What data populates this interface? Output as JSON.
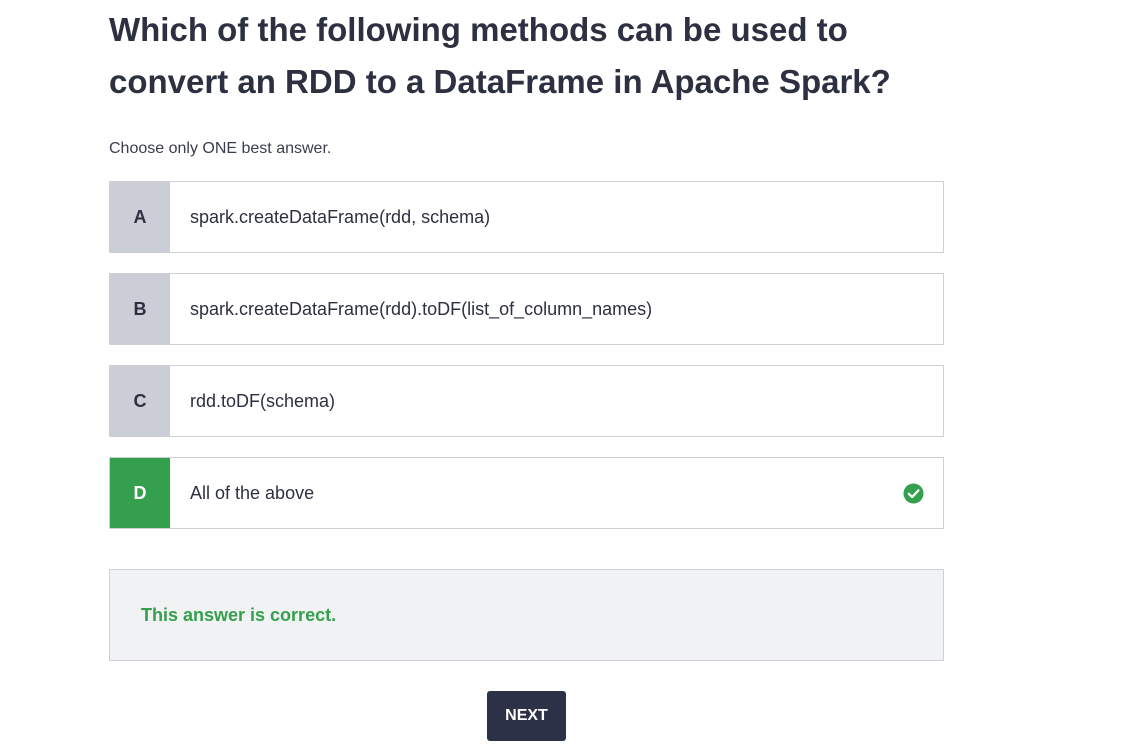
{
  "question": {
    "title": "Which of the following methods can be used to convert an RDD to a DataFrame in Apache Spark?",
    "instruction": "Choose only ONE best answer."
  },
  "options": [
    {
      "letter": "A",
      "text": "spark.createDataFrame(rdd, schema)",
      "correct": false
    },
    {
      "letter": "B",
      "text": "spark.createDataFrame(rdd).toDF(list_of_column_names)",
      "correct": false
    },
    {
      "letter": "C",
      "text": "rdd.toDF(schema)",
      "correct": false
    },
    {
      "letter": "D",
      "text": "All of the above",
      "correct": true,
      "icon": "check-circle-icon"
    }
  ],
  "feedback": {
    "text": "This answer is correct."
  },
  "actions": {
    "next_label": "NEXT"
  },
  "colors": {
    "correct_green": "#34a04d",
    "letter_gray": "#cbcdd7",
    "button_dark": "#2d3147",
    "text_dark": "#2d3040"
  }
}
